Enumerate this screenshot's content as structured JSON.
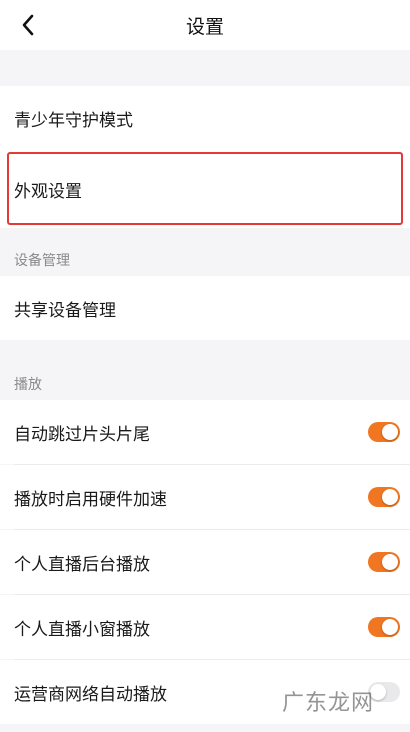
{
  "header": {
    "title": "设置"
  },
  "rows": {
    "youth_mode": "青少年守护模式",
    "appearance": "外观设置",
    "shared_devices": "共享设备管理",
    "auto_skip": "自动跳过片头片尾",
    "hw_accel": "播放时启用硬件加速",
    "live_background": "个人直播后台播放",
    "live_mini_window": "个人直播小窗播放",
    "carrier_autoplay": "运营商网络自动播放"
  },
  "sections": {
    "device_management": "设备管理",
    "playback": "播放"
  },
  "toggles": {
    "auto_skip": true,
    "hw_accel": true,
    "live_background": true,
    "live_mini_window": true,
    "carrier_autoplay": false
  },
  "watermark": "广东龙网",
  "colors": {
    "accent": "#f07622",
    "highlight_border": "#e53935",
    "background": "#f5f5f7"
  },
  "icons": {
    "back": "chevron-left-icon"
  }
}
